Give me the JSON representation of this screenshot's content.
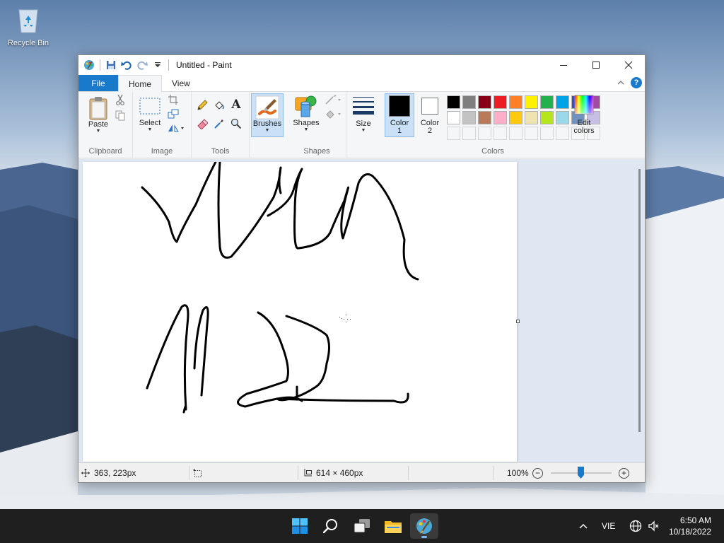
{
  "desktop": {
    "recycle_bin_label": "Recycle Bin"
  },
  "window": {
    "title": "Untitled - Paint",
    "tabs": {
      "file": "File",
      "home": "Home",
      "view": "View"
    },
    "help_label": "?"
  },
  "ribbon": {
    "clipboard": {
      "group_label": "Clipboard",
      "paste_label": "Paste"
    },
    "image": {
      "group_label": "Image",
      "select_label": "Select"
    },
    "tools": {
      "group_label": "Tools",
      "text_tool_label": "A"
    },
    "brushes": {
      "label": "Brushes"
    },
    "shapes": {
      "group_label": "Shapes",
      "shapes_label": "Shapes"
    },
    "size": {
      "label": "Size"
    },
    "colors": {
      "group_label": "Colors",
      "color1_label": "Color",
      "color1_num": "1",
      "color2_label": "Color",
      "color2_num": "2",
      "color1_value": "#000000",
      "color2_value": "#ffffff",
      "edit_colors_label_1": "Edit",
      "edit_colors_label_2": "colors",
      "palette_row1": [
        "#000000",
        "#7f7f7f",
        "#880015",
        "#ed1c24",
        "#ff7f27",
        "#fff200",
        "#22b14c",
        "#00a2e8",
        "#3f48cc",
        "#a349a4"
      ],
      "palette_row2": [
        "#ffffff",
        "#c3c3c3",
        "#b97a57",
        "#ffaec9",
        "#ffc90e",
        "#efe4b0",
        "#b5e61d",
        "#99d9ea",
        "#7092be",
        "#c8bfe7"
      ]
    }
  },
  "status": {
    "cursor_position": "363, 223px",
    "image_size": "614 × 460px",
    "zoom": "100%"
  },
  "taskbar": {
    "language": "VIE",
    "time": "6:50 AM",
    "date": "10/18/2022"
  },
  "colors": {
    "accent": "#1979ca",
    "taskbar_bg": "#1f1f1f"
  }
}
